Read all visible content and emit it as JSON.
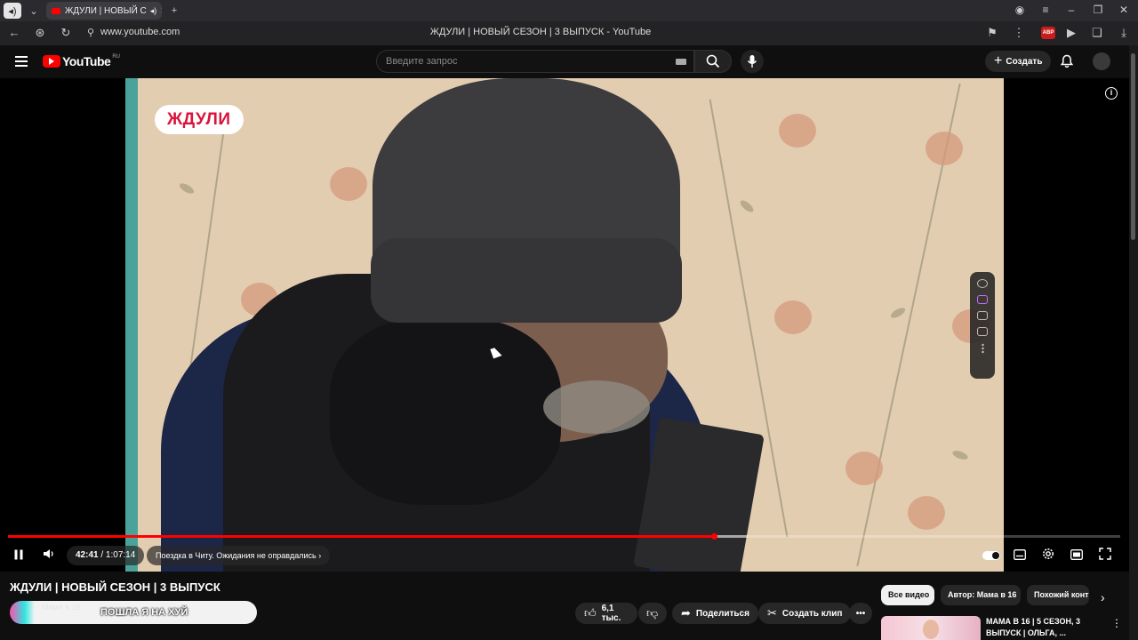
{
  "browser": {
    "tab_title": "ЖДУЛИ | НОВЫЙ С",
    "url": "www.youtube.com",
    "window_title": "ЖДУЛИ | НОВЫЙ СЕЗОН | 3 ВЫПУСК - YouTube",
    "abp_label": "ABP"
  },
  "masthead": {
    "logo_text": "YouTube",
    "logo_region": "RU",
    "search_placeholder": "Введите запрос",
    "create_label": "Создать"
  },
  "video": {
    "overlay_brand": "ЖДУЛИ",
    "current_time": "42:41",
    "duration": "1:07:14",
    "time_separator": " / ",
    "chapter": "Поездка в Читу. Ожидания не оправдались",
    "played_fraction": 0.635,
    "buffered_fraction": 0.665
  },
  "below": {
    "title": "ЖДУЛИ | НОВЫЙ СЕЗОН | 3 ВЫПУСК",
    "channel_partial": "Мама в 16",
    "comment_overlay": "ПОШЛА Я НА ХУЙ",
    "likes": "6,1 тыс.",
    "share_label": "Поделиться",
    "clip_label": "Создать клип"
  },
  "sidebar": {
    "chips": [
      "Все видео",
      "Автор: Мама в 16",
      "Похожий контент"
    ],
    "recommendation_title": "МАМА В 16 | 5 СЕЗОН, 3 ВЫПУСК | ОЛЬГА, ..."
  }
}
